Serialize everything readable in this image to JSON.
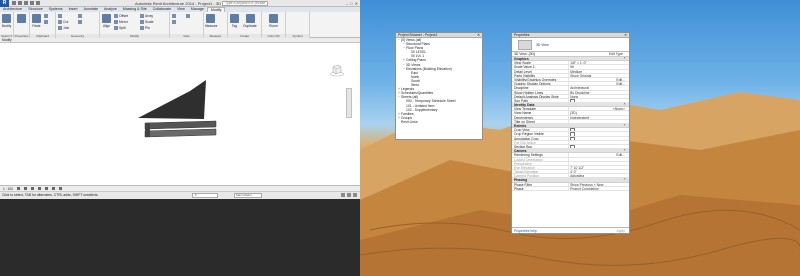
{
  "app": {
    "logo": "R",
    "title": "Autodesk Revit Architecture 2014 - Project1 - 3D View: {3D}",
    "search_placeholder": "Type a keyword or phrase",
    "window_buttons": [
      "–",
      "□",
      "✕"
    ]
  },
  "ribbon": {
    "tabs": [
      "Architecture",
      "Structure",
      "Systems",
      "Insert",
      "Annotate",
      "Analyze",
      "Massing & Site",
      "Collaborate",
      "View",
      "Manage",
      "Modify"
    ],
    "active_tab": "Modify",
    "panels": {
      "select": "Select ▾",
      "properties": "Properties",
      "clipboard": "Clipboard",
      "geometry": "Geometry",
      "modify": "Modify",
      "view": "View",
      "measure": "Measure",
      "create": "Create",
      "color_fill": "Color Fill",
      "symbol": "Symbol"
    },
    "tools": {
      "modify": "Modify",
      "paste": "Paste",
      "cut": "Cut",
      "join": "Join",
      "align": "Align",
      "offset": "Offset",
      "mirror": "Mirror",
      "split": "Split",
      "array": "Array",
      "scale": "Scale",
      "pin": "Pin",
      "measure": "Measure",
      "tag": "Tag",
      "duplicate": "Duplicate",
      "room": "Room"
    }
  },
  "options_bar": "Modify",
  "view_control": {
    "scale": "1 : 100"
  },
  "status": {
    "message": "Click to select, TAB for alternates, CTRL adds, SHIFT unselects.",
    "workset": ":0",
    "model": "Main Model"
  },
  "project_browser": {
    "title": "Project Browser - Project1",
    "items": [
      {
        "indent": 0,
        "twisty": "−",
        "label": "[0] Views (all)"
      },
      {
        "indent": 1,
        "twisty": "−",
        "label": "Structural Plans"
      },
      {
        "indent": 1,
        "twisty": "−",
        "label": "Floor Plans"
      },
      {
        "indent": 2,
        "twisty": "",
        "label": "00 LEVEL"
      },
      {
        "indent": 2,
        "twisty": "",
        "label": "00 LVL 1"
      },
      {
        "indent": 1,
        "twisty": "+",
        "label": "Ceiling Plans"
      },
      {
        "indent": 1,
        "twisty": "−",
        "label": "3D Views"
      },
      {
        "indent": 1,
        "twisty": "−",
        "label": "Elevations (Building Elevation)"
      },
      {
        "indent": 2,
        "twisty": "",
        "label": "East"
      },
      {
        "indent": 2,
        "twisty": "",
        "label": "North"
      },
      {
        "indent": 2,
        "twisty": "",
        "label": "South"
      },
      {
        "indent": 2,
        "twisty": "",
        "label": "West"
      },
      {
        "indent": 0,
        "twisty": "+",
        "label": "Legends"
      },
      {
        "indent": 0,
        "twisty": "+",
        "label": "Schedules/Quantities"
      },
      {
        "indent": 0,
        "twisty": "−",
        "label": "Sheets (all)"
      },
      {
        "indent": 1,
        "twisty": "",
        "label": "000 - Temporary Schedule Sheet"
      },
      {
        "indent": 1,
        "twisty": "",
        "label": "101 - Unlisted Item"
      },
      {
        "indent": 1,
        "twisty": "",
        "label": "102 - Supplementary"
      },
      {
        "indent": 0,
        "twisty": "+",
        "label": "Families"
      },
      {
        "indent": 0,
        "twisty": "+",
        "label": "Groups"
      },
      {
        "indent": 0,
        "twisty": "",
        "label": "Revit Links"
      }
    ]
  },
  "properties": {
    "title": "Properties",
    "type_name": "3D View",
    "selector": "3D View: {3D}",
    "edit_type": "Edit Type",
    "groups": [
      {
        "name": "Graphics",
        "rows": [
          {
            "k": "View Scale",
            "v": "1/8\" = 1'-0\""
          },
          {
            "k": "Scale Value    1:",
            "v": "96"
          },
          {
            "k": "Detail Level",
            "v": "Medium"
          },
          {
            "k": "Parts Visibility",
            "v": "Show Original"
          },
          {
            "k": "Visibility/Graphics Overrides",
            "v": "Edit...",
            "btn": true
          },
          {
            "k": "Graphic Display Options",
            "v": "Edit...",
            "btn": true
          },
          {
            "k": "Discipline",
            "v": "Architectural"
          },
          {
            "k": "Show Hidden Lines",
            "v": "By Discipline"
          },
          {
            "k": "Default Analysis Display Style",
            "v": "None"
          },
          {
            "k": "Sun Path",
            "v": "",
            "chk": true
          }
        ]
      },
      {
        "name": "Identity Data",
        "rows": [
          {
            "k": "View Template",
            "v": "<None>",
            "btn": true
          },
          {
            "k": "View Name",
            "v": "{3D}"
          },
          {
            "k": "Dependency",
            "v": "Independent"
          },
          {
            "k": "Title on Sheet",
            "v": ""
          }
        ]
      },
      {
        "name": "Extents",
        "rows": [
          {
            "k": "Crop View",
            "v": "",
            "chk": true
          },
          {
            "k": "Crop Region Visible",
            "v": "",
            "chk": true
          },
          {
            "k": "Annotation Crop",
            "v": "",
            "chk": true
          },
          {
            "k": "Far Clip Active",
            "v": "",
            "dim": true
          },
          {
            "k": "Section Box",
            "v": "",
            "chk": true
          }
        ]
      },
      {
        "name": "Camera",
        "rows": [
          {
            "k": "Rendering Settings",
            "v": "Edit...",
            "btn": true
          },
          {
            "k": "Locked Orientation",
            "v": "",
            "dim": true
          },
          {
            "k": "Perspective",
            "v": "",
            "dim": true
          },
          {
            "k": "Eye Elevation",
            "v": "7' 10 1/2\"",
            "dim": true
          },
          {
            "k": "Target Elevation",
            "v": "4' 0\"",
            "dim": true
          },
          {
            "k": "Camera Position",
            "v": "Adjusting",
            "dim": true
          }
        ]
      },
      {
        "name": "Phasing",
        "rows": [
          {
            "k": "Phase Filter",
            "v": "Show Previous + New"
          },
          {
            "k": "Phase",
            "v": "Project Completion"
          }
        ]
      }
    ],
    "help_link": "Properties help",
    "apply": "Apply"
  }
}
